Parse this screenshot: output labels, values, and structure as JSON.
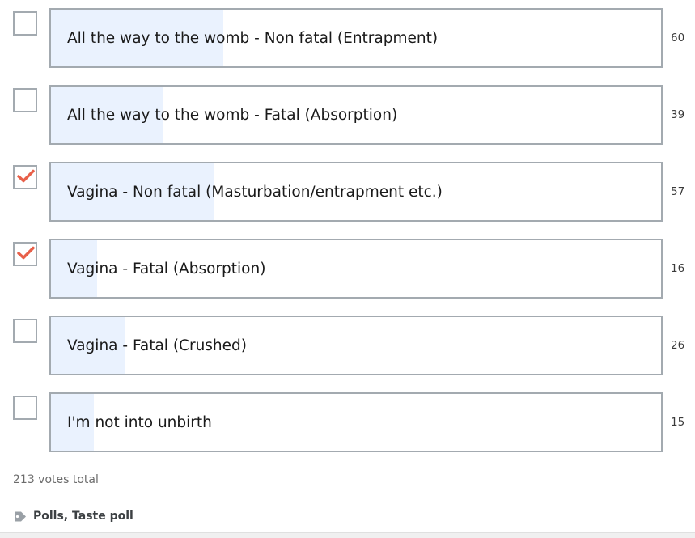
{
  "poll": {
    "options": [
      {
        "label": "All the way to the womb - Non fatal (Entrapment)",
        "votes": "60",
        "checked": false,
        "share": 0.282
      },
      {
        "label": "All the way to the womb - Fatal (Absorption)",
        "votes": "39",
        "checked": false,
        "share": 0.183
      },
      {
        "label": "Vagina - Non fatal (Masturbation/entrapment etc.)",
        "votes": "57",
        "checked": true,
        "share": 0.268
      },
      {
        "label": "Vagina - Fatal (Absorption)",
        "votes": "16",
        "checked": true,
        "share": 0.075
      },
      {
        "label": "Vagina - Fatal (Crushed)",
        "votes": "26",
        "checked": false,
        "share": 0.122
      },
      {
        "label": "I'm not into unbirth",
        "votes": "15",
        "checked": false,
        "share": 0.07
      }
    ],
    "total_label": "213 votes total"
  },
  "tags": {
    "icon": "tag-icon",
    "text": "Polls, Taste poll"
  },
  "colors": {
    "fill": "#eaf2fe",
    "border": "#a3aab0",
    "check": "#e8604a"
  }
}
